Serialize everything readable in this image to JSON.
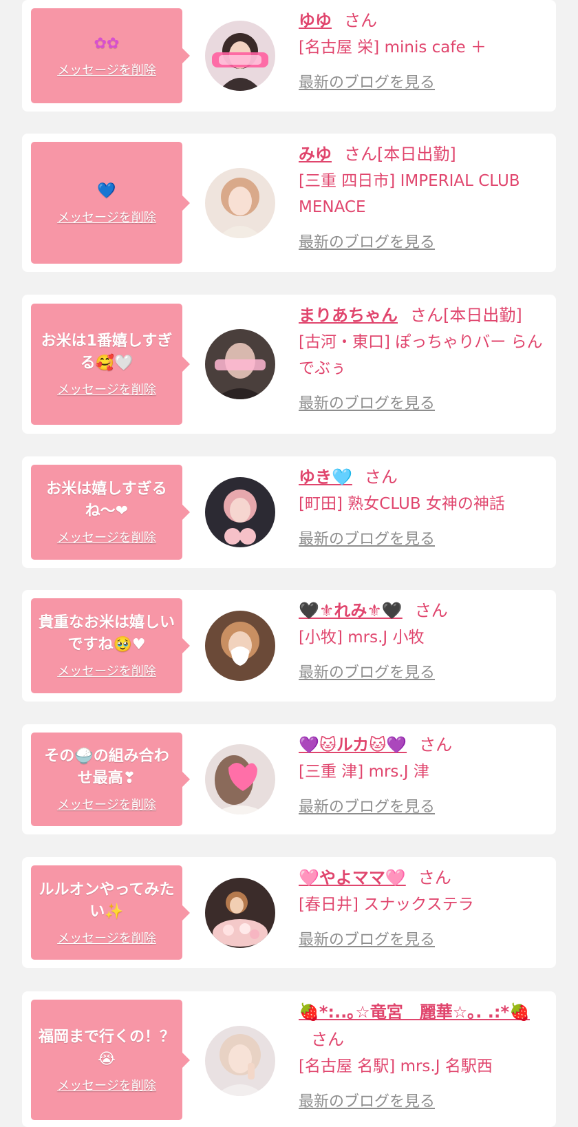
{
  "common": {
    "delete_label": "メッセージを削除",
    "blog_label": "最新のブログを見る",
    "san": "さん"
  },
  "colors": {
    "background": "#f2f2f2",
    "bubble": "#f796a6",
    "name": "#e0456d",
    "link_gray": "#8d8d8d"
  },
  "cards": [
    {
      "message": "✿✿",
      "name": "ゆゆ",
      "status": "",
      "shop": "[名古屋 栄] minis cafe ＋"
    },
    {
      "message": "💙",
      "name": "みゆ",
      "status": "[本日出勤]",
      "shop": "[三重 四日市] IMPERIAL CLUB MENACE"
    },
    {
      "message": "お米は1番嬉しすぎる🥰🤍",
      "name": "まりあちゃん",
      "status": "[本日出勤]",
      "shop": "[古河・東口] ぽっちゃりバー らんでぶぅ"
    },
    {
      "message": "お米は嬉しすぎるね〜❤",
      "name": "ゆき🩵",
      "status": "",
      "shop": "[町田] 熟女CLUB 女神の神話"
    },
    {
      "message": "貴重なお米は嬉しいですね🥹♥",
      "name": "🖤⚜れみ⚜🖤",
      "status": "",
      "shop": "[小牧] mrs.J 小牧"
    },
    {
      "message": "その🍚の組み合わせ最高❣",
      "name": "💜🐱ルカ🐱💜",
      "status": "",
      "shop": "[三重 津] mrs.J 津"
    },
    {
      "message": "ルルオンやってみたい✨",
      "name": "🩷やよママ🩷",
      "status": "",
      "shop": "[春日井] スナックステラ"
    },
    {
      "message": "福岡まで行くの！？😭",
      "name": "🍓*:..｡☆竜宮　麗華☆｡. .:*🍓",
      "status": "",
      "shop": "[名古屋 名駅] mrs.J 名駅西"
    }
  ]
}
